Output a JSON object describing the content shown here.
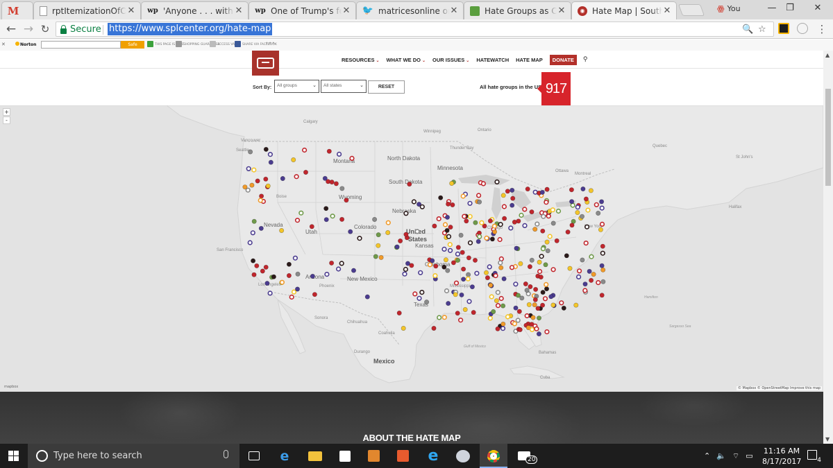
{
  "browser": {
    "tabs": [
      {
        "title": "rptItemizationOfCharc",
        "icon": "document-icon"
      },
      {
        "title": "'Anyone . . . with a pul",
        "icon": "washington-post-icon"
      },
      {
        "title": "One of Trump's foreig",
        "icon": "washington-post-icon"
      },
      {
        "title": "matricesonline on Twi",
        "icon": "twitter-icon"
      },
      {
        "title": "Hate Groups as Charit",
        "icon": "green-leaf-icon"
      },
      {
        "title": "Hate Map | Southern",
        "icon": "splc-icon",
        "active": true
      }
    ],
    "gmail_glyph": "M",
    "profile_name": "You",
    "secure_label": "Secure",
    "url": "https://www.splcenter.org/hate-map"
  },
  "norton": {
    "brand": "Norton",
    "search_button": "Safe Search",
    "items": [
      "THIS PAGE IS SAFE",
      "SHOPPING GUARANTEE",
      "ACCESS VAULT",
      "SHARE VIA FACEBOOK"
    ]
  },
  "site": {
    "nav": [
      {
        "label": "RESOURCES",
        "caret": true
      },
      {
        "label": "WHAT WE DO",
        "caret": true
      },
      {
        "label": "OUR ISSUES",
        "caret": true
      },
      {
        "label": "HATEWATCH",
        "caret": false
      },
      {
        "label": "HATE MAP",
        "caret": false
      }
    ],
    "donate": "DONATE",
    "filters": {
      "sort_by": "Sort By:",
      "groups_value": "All groups",
      "states_value": "All states",
      "reset": "RESET"
    },
    "count_label": "All hate groups in the US:",
    "count": "917",
    "accent": "#d7242b"
  },
  "map": {
    "zoom_in": "+",
    "zoom_out": "-",
    "attribution": "© Mapbox © OpenStreetMap Improve this map",
    "places": [
      "Calgary",
      "Winnipeg",
      "Vancouver",
      "Seattle",
      "Thunder Bay",
      "Montana",
      "North Dakota",
      "Minnesota",
      "Montreal",
      "Boise",
      "South Dakota",
      "Wyoming",
      "Nebraska",
      "Nevada",
      "Utah",
      "Colorado",
      "United States",
      "Kansas",
      "San Francisco",
      "Los Angeles",
      "Arizona",
      "New Mexico",
      "Phoenix",
      "Oklahoma",
      "Texas",
      "Chihuahua",
      "Sonora",
      "Coahuila",
      "Durango",
      "Mexico",
      "Cuba",
      "Bahamas",
      "New York",
      "Ontario",
      "Quebec",
      "Halifax",
      "St John's",
      "Ottawa",
      "Chicago",
      "Mississippi"
    ],
    "water": [
      "Gulf of Mexico",
      "Sargasso Sea",
      "Hamilton"
    ],
    "legend_colors": {
      "red": "#c0262d",
      "dark": "#2b1a1a",
      "purple": "#4b3c8f",
      "orange": "#f09a2a",
      "yellow": "#f3c52a",
      "green": "#6f9a4a",
      "grey": "#8a8a8a"
    }
  },
  "about": {
    "title": "ABOUT THE HATE MAP"
  },
  "taskbar": {
    "search_placeholder": "Type here to search",
    "time": "11:16 AM",
    "date": "8/17/2017",
    "mail_badge": "20",
    "notifications": "4"
  }
}
